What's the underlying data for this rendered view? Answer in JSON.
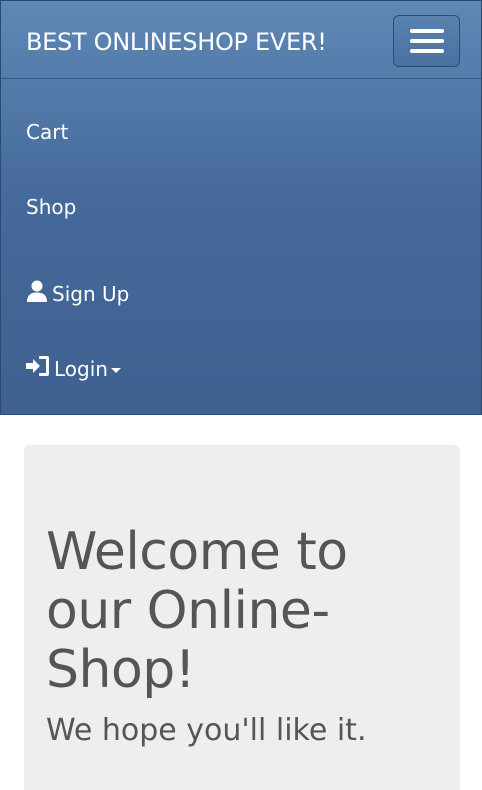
{
  "navbar": {
    "brand": "BEST ONLINESHOP EVER!",
    "items": [
      {
        "label": "Cart"
      },
      {
        "label": "Shop"
      },
      {
        "label": "Sign Up",
        "icon": "user-icon"
      },
      {
        "label": "Login",
        "icon": "login-icon"
      }
    ]
  },
  "jumbotron": {
    "title": "Welcome to our Online-Shop!",
    "subtitle": "We hope you'll like it."
  },
  "colors": {
    "navbar_top": "#5f88b5",
    "navbar_bottom": "#3f6190",
    "jumbotron_bg": "#eeeeee",
    "jumbotron_text": "#555555"
  }
}
